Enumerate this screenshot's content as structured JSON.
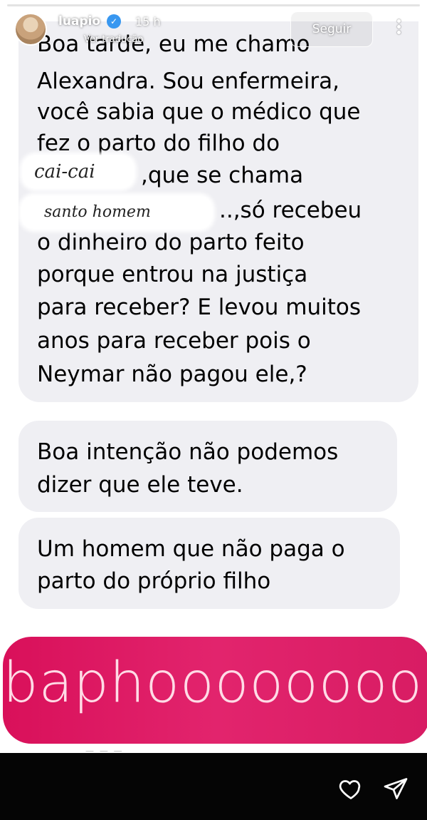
{
  "header": {
    "username": "luapio",
    "verified_icon": "verified-badge-icon",
    "time_ago": "15 h",
    "translate_label": "Ver tradução",
    "follow_label": "Seguir",
    "more_icon": "more-options-icon"
  },
  "messages": {
    "bubble1": {
      "lines": [
        "Boa tarde, eu me chamo",
        "Alexandra. Sou enfermeira,",
        "você sabia que o médico que",
        "fez o parto do filho do",
        ",que se chama",
        "..,só recebeu",
        "o dinheiro do parto feito",
        "porque entrou na justiça",
        "para receber? E levou muitos",
        "anos  para receber pois o",
        "Neymar não pagou ele,?"
      ]
    },
    "bubble2": {
      "lines": [
        "Boa intenção não podemos",
        "dizer que ele  teve."
      ]
    },
    "bubble3": {
      "lines": [
        "Um homem que não paga o",
        "parto do próprio filho"
      ]
    }
  },
  "stickers": {
    "cai_cai": "cai-cai",
    "santo_homem": "santo homem"
  },
  "banner": {
    "text": "baphoooooooo"
  },
  "footer": {
    "like_icon": "heart-icon",
    "share_icon": "send-icon"
  },
  "colors": {
    "bubble": "#efeff3",
    "banner": "#e2246d",
    "banner_text": "#ffdbe6",
    "bottom_bar": "#050505"
  }
}
